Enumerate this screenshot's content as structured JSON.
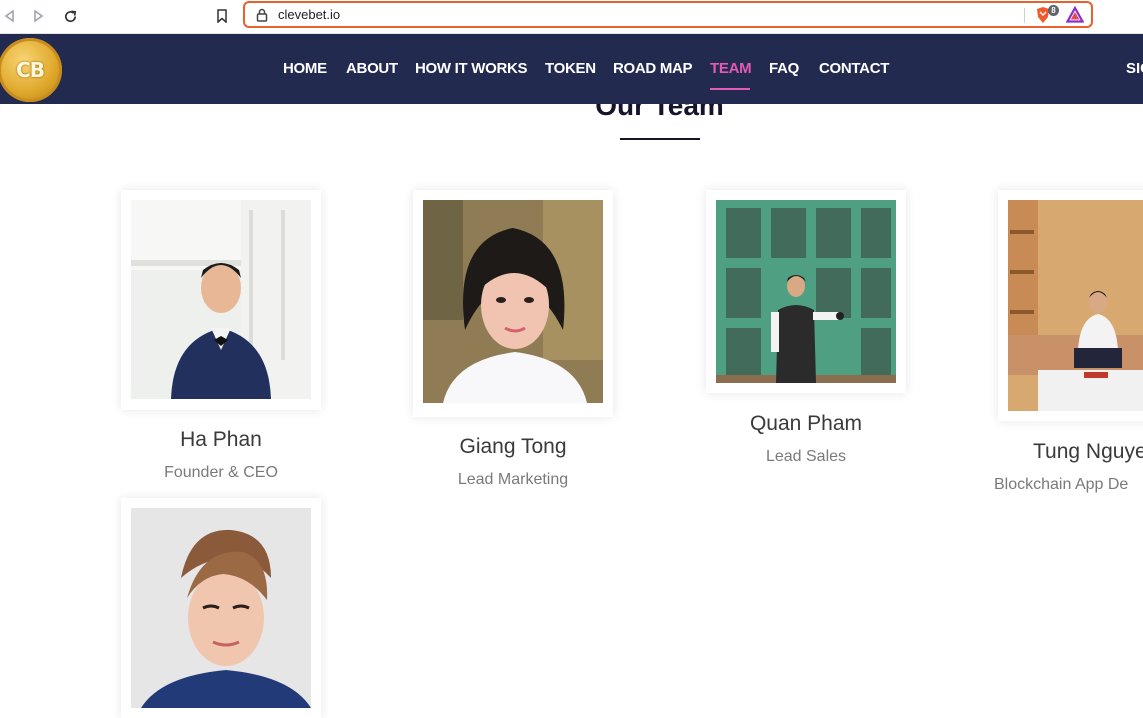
{
  "browser": {
    "url": "clevebet.io",
    "shield_count": "8"
  },
  "header": {
    "logo_text": "CB",
    "nav": [
      {
        "label": "HOME"
      },
      {
        "label": "ABOUT"
      },
      {
        "label": "HOW IT WORKS"
      },
      {
        "label": "TOKEN"
      },
      {
        "label": "ROAD MAP"
      },
      {
        "label": "TEAM",
        "active": true
      },
      {
        "label": "FAQ"
      },
      {
        "label": "CONTACT"
      }
    ],
    "sign_label": "SIG"
  },
  "section": {
    "title": "Our Team"
  },
  "team": [
    {
      "name": "Ha Phan",
      "role": "Founder & CEO"
    },
    {
      "name": "Giang Tong",
      "role": "Lead Marketing"
    },
    {
      "name": "Quan Pham",
      "role": "Lead Sales"
    },
    {
      "name": "Tung Nguye",
      "role": "Blockchain App De"
    },
    {
      "name": "",
      "role": ""
    }
  ],
  "colors": {
    "header_bg": "#232a4f",
    "accent": "#e45ab6",
    "address_border": "#e8602c"
  }
}
